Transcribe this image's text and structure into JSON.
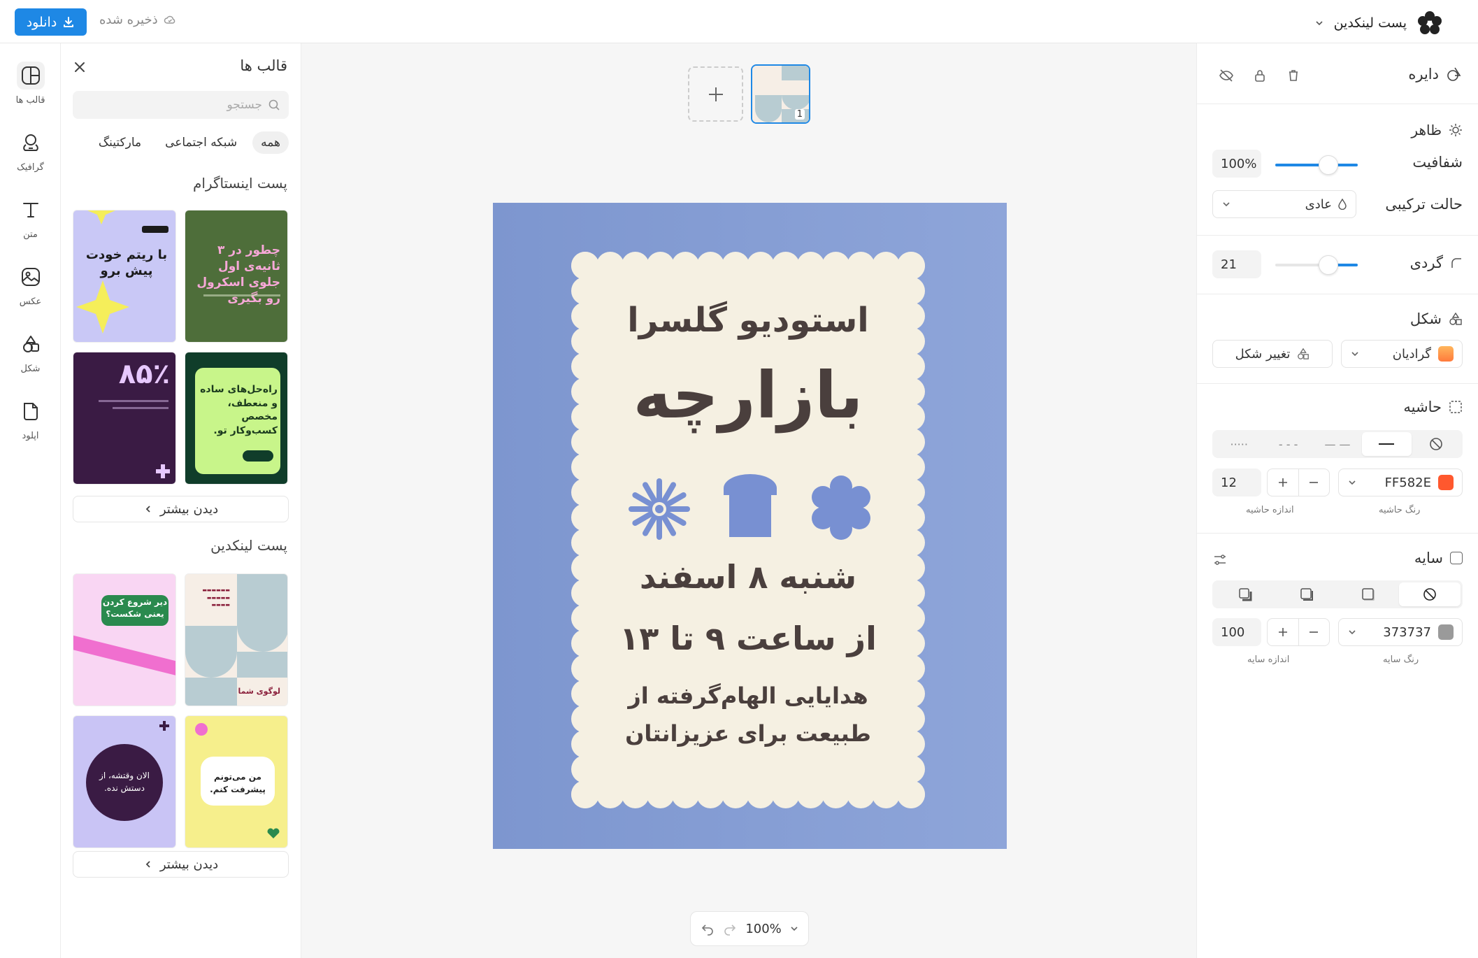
{
  "topbar": {
    "download_label": "دانلود",
    "saved_label": "ذخیره شده",
    "doc_title": "پست لینکدین"
  },
  "rail": {
    "items": [
      {
        "label": "قالب ها",
        "icon": "templates-icon"
      },
      {
        "label": "گرافیک",
        "icon": "graphics-icon"
      },
      {
        "label": "متن",
        "icon": "text-icon"
      },
      {
        "label": "عکس",
        "icon": "photo-icon"
      },
      {
        "label": "شکل",
        "icon": "shape-icon"
      },
      {
        "label": "اپلود",
        "icon": "upload-icon"
      }
    ]
  },
  "templates_panel": {
    "title": "قالب ها",
    "search_placeholder": "جستجو",
    "chips": [
      "همه",
      "شبکه اجتماعی",
      "مارکتینگ"
    ],
    "sections": [
      {
        "title": "پست اینستاگرام",
        "more_label": "دیدن بیشتر",
        "thumbs": [
          {
            "text": "چطور در ۳ ثانیه‌ی اول جلوی اسکرول رو بگیری",
            "bg": "#4e6e3a",
            "fg": "#f7a8d8"
          },
          {
            "text": "با ریتم خودت پیش برو",
            "bg": "#c9c8f6",
            "fg": "#1b1b1b"
          },
          {
            "text": "راه‌حل‌های ساده و منعطف، مخصص کسب‌وکار تو.",
            "bg": "#103d2a",
            "fg": "#1b3a1e"
          },
          {
            "text": "۸۵٪",
            "bg": "#3a1b44",
            "fg": "#e7c8ff"
          }
        ]
      },
      {
        "title": "پست لینکدین",
        "more_label": "دیدن بیشتر",
        "thumbs": [
          {
            "text": "لوگوی شما",
            "bg": "#f6eee6",
            "fg": "#8a1f3b"
          },
          {
            "text": "دیر شروع کردن یعنی شکست؟",
            "bg": "#f9d6f3",
            "fg": "#ffffff"
          },
          {
            "text": "من می‌تونم پیشرفت کنم.",
            "bg": "#f6ef8c",
            "fg": "#222222"
          },
          {
            "text": "الان وقتشه، از دستش نده.",
            "bg": "#c9c4f5",
            "fg": "#ffffff"
          }
        ]
      }
    ]
  },
  "canvas": {
    "page_number": "1",
    "zoom": "100%",
    "poster": {
      "line1": "استودیو گلسرا",
      "line2": "بازارچه",
      "line3": "شنبه ۸ اسفند",
      "line4": "از ساعت ۹ تا ۱۳",
      "line5a": "هدایایی الهام‌گرفته از",
      "line5b": "طبیعت برای عزیزانتان"
    }
  },
  "right_panel": {
    "element_title": "دایره",
    "appearance_title": "ظاهر",
    "opacity_label": "شفافیت",
    "opacity_value": "100%",
    "opacity_fraction": 1.0,
    "blend_label": "حالت ترکیبی",
    "blend_value": "عادی",
    "radius_label": "گردی",
    "radius_value": "21",
    "shape_title": "شکل",
    "fill_label": "گرادیان",
    "change_shape_label": "تغییر شکل",
    "border_title": "حاشیه",
    "border_color_value": "FF582E",
    "border_color_hex": "#ff582e",
    "border_color_caption": "رنگ حاشیه",
    "border_size_value": "12",
    "border_size_caption": "اندازه حاشیه",
    "shadow_title": "سایه",
    "shadow_color_value": "373737",
    "shadow_color_caption": "رنگ سایه",
    "shadow_size_value": "100",
    "shadow_size_caption": "اندازه سایه"
  },
  "colors": {
    "accent": "#1e88e5",
    "poster_bg": "#8aa0d6",
    "poster_card": "#f5f0e2",
    "poster_text": "#4a3f3d",
    "poster_shape": "#7890d2"
  }
}
